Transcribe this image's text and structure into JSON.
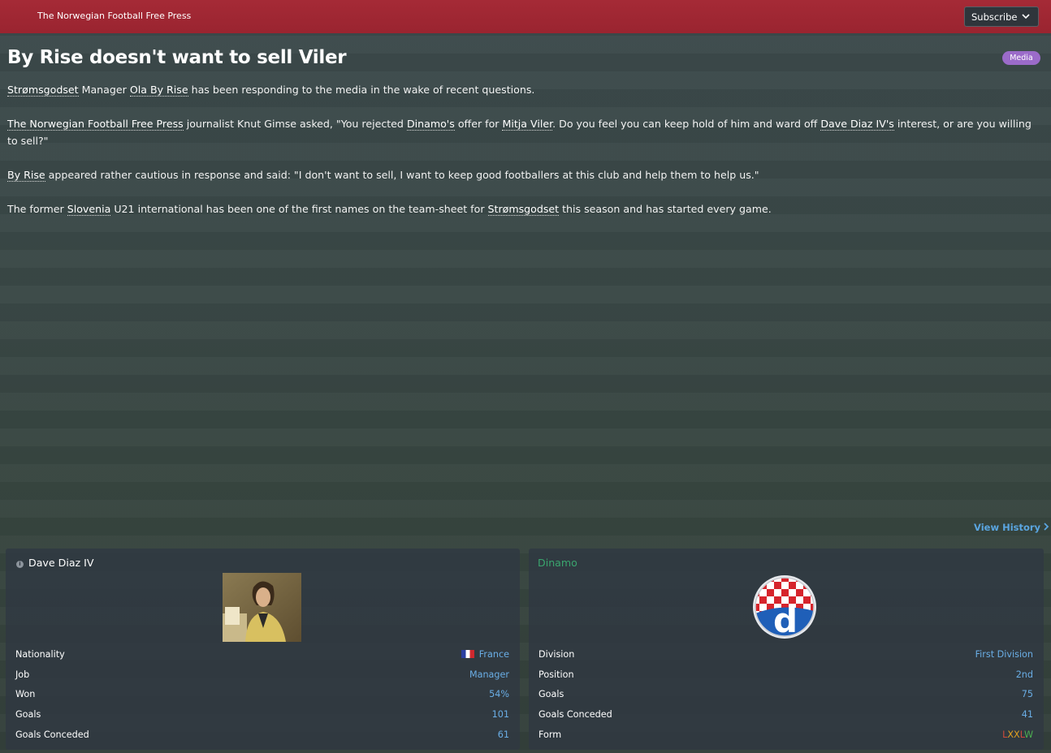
{
  "header": {
    "publication": "The Norwegian Football Free Press",
    "subscribe_label": "Subscribe"
  },
  "article": {
    "headline": "By Rise doesn't want to sell Viler",
    "badge": "Media",
    "p1": {
      "club": "Strømsgodset",
      "t1": " Manager ",
      "manager": "Ola By Rise",
      "t2": " has been responding to the media in the wake of recent questions."
    },
    "p2": {
      "paper": "The Norwegian Football Free Press",
      "t1": " journalist Knut Gimse asked, \"You rejected ",
      "club": "Dinamo's",
      "t2": " offer for ",
      "player": "Mitja Viler",
      "t3": ". Do you feel you can keep hold of him and ward off ",
      "rival": "Dave Diaz IV's",
      "t4": " interest, or are you willing to sell?\""
    },
    "p3": {
      "person": "By Rise",
      "t1": " appeared rather cautious in response and said: \"I don't want to sell, I want to keep good footballers at this club and help them to help us.\""
    },
    "p4": {
      "t1": "The former ",
      "nation": "Slovenia",
      "t2": " U21 international has been one of the first names on the team-sheet for ",
      "club": "Strømsgodset",
      "t3": " this season and has started every game."
    },
    "view_history": "View History"
  },
  "manager_panel": {
    "name": "Dave Diaz IV",
    "rows": [
      {
        "label": "Nationality",
        "value": "France"
      },
      {
        "label": "Job",
        "value": "Manager"
      },
      {
        "label": "Won",
        "value": "54%"
      },
      {
        "label": "Goals",
        "value": "101"
      },
      {
        "label": "Goals Conceded",
        "value": "61"
      }
    ]
  },
  "club_panel": {
    "name": "Dinamo",
    "rows": [
      {
        "label": "Division",
        "value": "First Division"
      },
      {
        "label": "Position",
        "value": "2nd"
      },
      {
        "label": "Goals",
        "value": "75"
      },
      {
        "label": "Goals Conceded",
        "value": "41"
      },
      {
        "label": "Form",
        "value": "LXXLW"
      }
    ],
    "form": [
      "L",
      "X",
      "X",
      "L",
      "W"
    ]
  },
  "colors": {
    "topbar": "#a52a36",
    "badge": "#9b6bc9",
    "link_value": "#6aaee6",
    "club_name": "#3aa56e",
    "form_loss": "#d24a3c",
    "form_draw": "#e0a020",
    "form_win": "#4caf50"
  },
  "icons": {
    "subscribe": "chevron-down-icon",
    "view_history": "chevron-right-icon",
    "info": "info-icon",
    "nationality": "france-flag-icon"
  }
}
